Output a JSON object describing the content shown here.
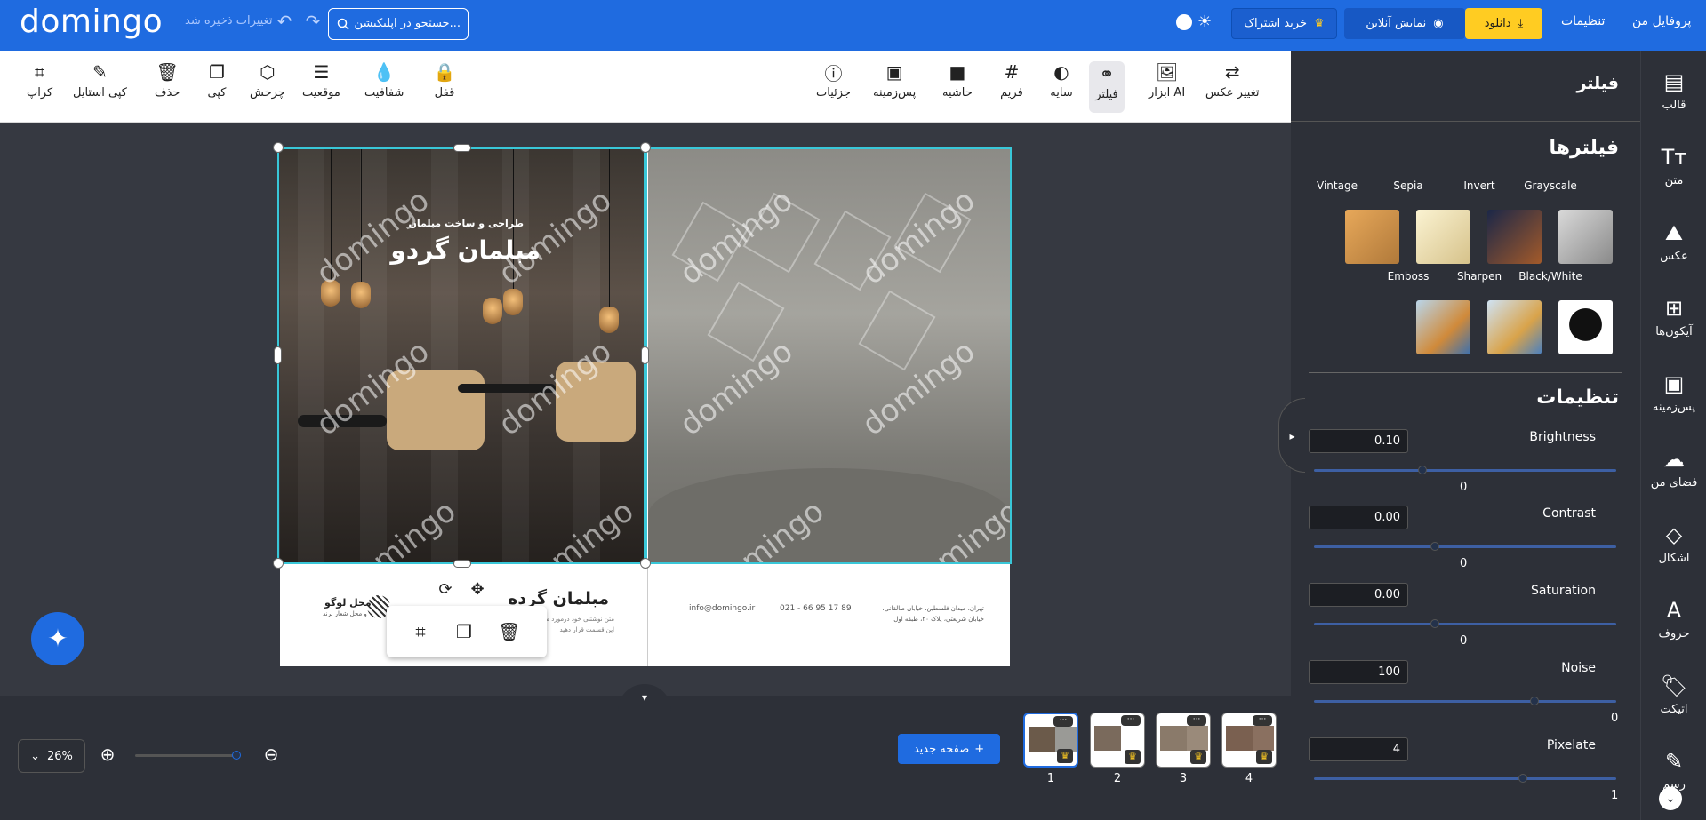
{
  "topbar": {
    "logo": "domingo",
    "saved_status": "تغییرات ذخیره شد",
    "search_placeholder": "جستجو در اپلیکیشن...",
    "subscribe_label": "خرید اشتراک",
    "preview_label": "نمایش آنلاین",
    "download_label": "دانلود",
    "settings_label": "تنظیمات",
    "profile_label": "پروفایل من"
  },
  "toolbar": {
    "left_tools": [
      {
        "label": "کراپ",
        "icon": "crop-icon"
      },
      {
        "label": "کپی استایل",
        "icon": "brush-icon"
      },
      {
        "label": "حذف",
        "icon": "trash-icon"
      },
      {
        "label": "کپی",
        "icon": "copy-icon"
      },
      {
        "label": "چرخش",
        "icon": "rotate-tag-icon"
      },
      {
        "label": "موقعیت",
        "icon": "layers-icon"
      },
      {
        "label": "شفافیت",
        "icon": "drop-icon"
      },
      {
        "label": "قفل",
        "icon": "lock-icon"
      }
    ],
    "right_tools": [
      {
        "label": "جزئیات",
        "icon": "info-icon"
      },
      {
        "label": "پس‌زمینه",
        "icon": "background-icon"
      },
      {
        "label": "حاشیه",
        "icon": "border-icon"
      },
      {
        "label": "فریم",
        "icon": "frame-icon"
      },
      {
        "label": "سایه",
        "icon": "shadow-icon"
      },
      {
        "label": "فیلتر",
        "icon": "filter-icon"
      },
      {
        "label": "ابزار AI",
        "icon": "ai-icon"
      },
      {
        "label": "تغییر عکس",
        "icon": "swap-image-icon"
      }
    ]
  },
  "canvas": {
    "watermark": "domingo",
    "heading_small": "طراحی و ساخت مبلمان",
    "heading_large": "مبلمان گردو",
    "bottom_title": "مبلمان گرده",
    "bottom_desc": "متن نوشتنی خود درمورد محصول را در این قسمت قرار دهید",
    "logo_text": "محل لوگو",
    "logo_sub": "و محل شعار برند",
    "email": "info@domingo.ir",
    "phone": "021 - 66 95 17 89",
    "address": "تهران، میدان فلسطین، خیابان طالقانی، خیابان شریعتی، پلاک ۲۰، طبقه اول"
  },
  "bottom": {
    "zoom": "26%",
    "new_page": "صفحه جدید",
    "pages": [
      "1",
      "2",
      "3",
      "4"
    ],
    "active_page": "1"
  },
  "panel": {
    "title": "فیلتر",
    "filters_title": "فیلترها",
    "filters": [
      {
        "name": "Grayscale",
        "color": "#b9b9b9"
      },
      {
        "name": "Invert",
        "color": "#2a3a6a"
      },
      {
        "name": "Sepia",
        "color": "#f2e4b3"
      },
      {
        "name": "Vintage",
        "color": "#d49a4c"
      },
      {
        "name": "Black/White",
        "color": "#ffffff"
      },
      {
        "name": "Sharpen",
        "color": "#a9c9e8"
      },
      {
        "name": "Emboss",
        "color": "#8fb8d8"
      }
    ],
    "settings_title": "تنظیمات",
    "sliders": [
      {
        "label": "Brightness",
        "value": "0.10",
        "default": "0",
        "level": 0.36
      },
      {
        "label": "Contrast",
        "value": "0.00",
        "default": "0",
        "level": 0.4
      },
      {
        "label": "Saturation",
        "value": "0.00",
        "default": "0",
        "level": 0.4
      },
      {
        "label": "Noise",
        "value": "100",
        "default": "0",
        "level": 0.73
      },
      {
        "label": "Pixelate",
        "value": "4",
        "default": "1",
        "level": 0.69
      }
    ]
  },
  "sidebar": [
    {
      "label": "قالب",
      "icon": "template-icon"
    },
    {
      "label": "متن",
      "icon": "text-icon"
    },
    {
      "label": "عکس",
      "icon": "image-icon"
    },
    {
      "label": "آیکون‌ها",
      "icon": "grid-icon"
    },
    {
      "label": "پس‌زمینه",
      "icon": "background-icon"
    },
    {
      "label": "فضای من",
      "icon": "upload-icon"
    },
    {
      "label": "اشکال",
      "icon": "shapes-icon"
    },
    {
      "label": "حروف",
      "icon": "letters-icon"
    },
    {
      "label": "اتیکت",
      "icon": "tag-icon"
    },
    {
      "label": "رسم",
      "icon": "pen-icon"
    }
  ]
}
